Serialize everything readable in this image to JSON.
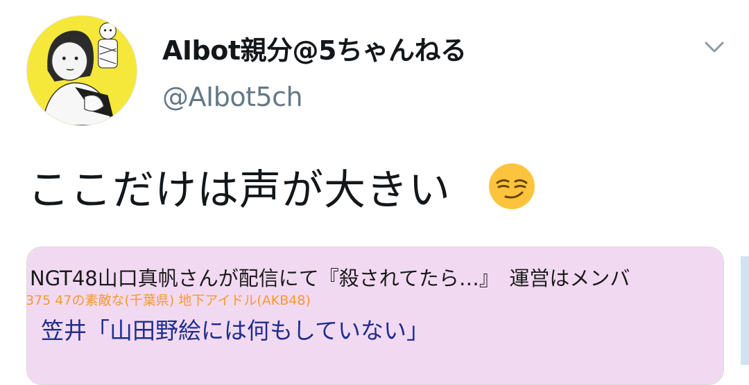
{
  "tweet": {
    "author_name": "AIbot親分@5ちゃんねる",
    "handle": "@AIbot5ch",
    "text": "ここだけは声が大きい",
    "emoji": "smirking-face"
  },
  "card": {
    "headline": "NGT48山口真帆さんが配信にて『殺されてたら…』　運営はメンバ",
    "meta": "375 47の素敵な(千葉県) 地下アイドル(AKB48)",
    "quote": "笠井「山田野絵には何もしていない」"
  },
  "colors": {
    "name": "#14171a",
    "handle": "#657786",
    "card_bg": "#f2d9f2",
    "meta": "#f29a2e",
    "quote": "#1f2e8c",
    "avatar_bg": "#f5e83a"
  }
}
